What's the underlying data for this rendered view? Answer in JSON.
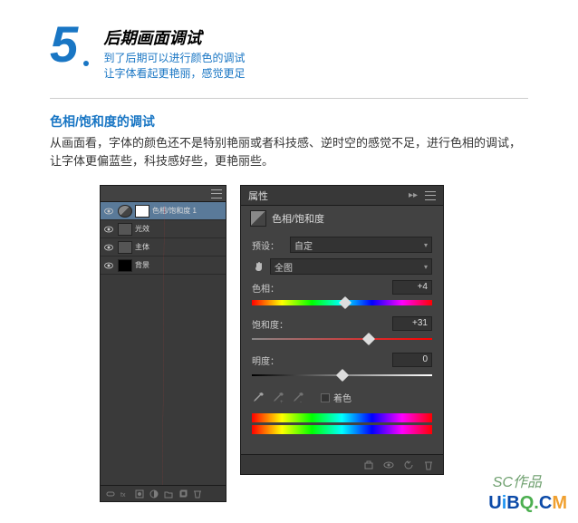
{
  "header": {
    "step_number": "5",
    "title": "后期画面调试",
    "subtitle1": "到了后期可以进行颜色的调试",
    "subtitle2": "让字体看起更艳丽，感觉更足"
  },
  "content": {
    "title": "色相/饱和度的调试",
    "body": "从画面看，字体的颜色还不是特别艳丽或者科技感、逆时空的感觉不足，进行色相的调试，让字体更偏蓝些，科技感好些，更艳丽些。"
  },
  "layers_panel": {
    "rows": [
      {
        "label": "色相/饱和度 1",
        "type": "adjust",
        "selected": true
      },
      {
        "label": "光效",
        "type": "normal",
        "selected": false
      },
      {
        "label": "主体",
        "type": "normal",
        "selected": false
      },
      {
        "label": "背景",
        "type": "bg",
        "selected": false
      }
    ]
  },
  "props_panel": {
    "tab": "属性",
    "title": "色相/饱和度",
    "preset_label": "预设：",
    "preset_value": "自定",
    "range_value": "全图",
    "sliders": {
      "hue": {
        "label": "色相：",
        "value": "+4",
        "pos": 52
      },
      "sat": {
        "label": "饱和度：",
        "value": "+31",
        "pos": 65
      },
      "light": {
        "label": "明度：",
        "value": "0",
        "pos": 50
      }
    },
    "colorize_label": "着色"
  },
  "watermark": {
    "sc": "SC作品",
    "text_u": "U",
    "text_i": "i",
    "text_b": "B",
    "text_q": "Q.",
    "text_c": "C",
    "text_m": "M"
  }
}
